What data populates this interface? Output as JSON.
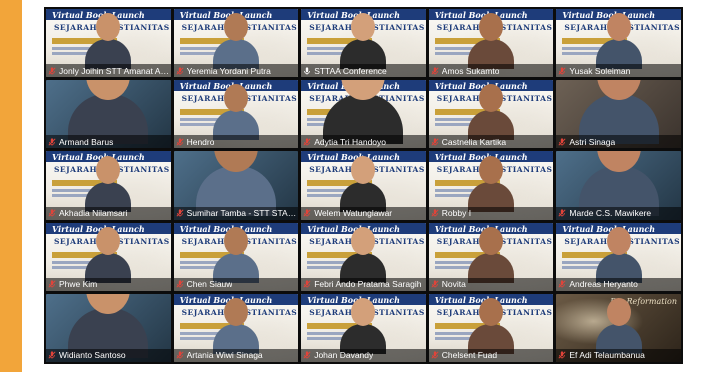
{
  "banner": {
    "script_title": "Virtual Book Launch",
    "main_title": "SEJARAH KRISTIANITAS"
  },
  "painting_caption": "Die Reformation",
  "colors": {
    "accent": "#f2a53a",
    "banner_blue": "#1e3c7a",
    "speaking_border": "#9ad94a",
    "muted_mic": "#e0443a"
  },
  "participants": [
    {
      "name": "Jonly Joihin STT Amanat Ag...",
      "mic": "muted",
      "video": "banner"
    },
    {
      "name": "Yeremia Yordani Putra",
      "mic": "muted",
      "video": "banner",
      "speaking": true
    },
    {
      "name": "STTAA Conference",
      "mic": "unmuted",
      "video": "banner"
    },
    {
      "name": "Amos Sukamto",
      "mic": "muted",
      "video": "banner"
    },
    {
      "name": "Yusak Soleiman",
      "mic": "muted",
      "video": "banner"
    },
    {
      "name": "Armand Barus",
      "mic": "muted",
      "video": "camera"
    },
    {
      "name": "Hendro",
      "mic": "muted",
      "video": "banner"
    },
    {
      "name": "Adytia Tri Handoyo",
      "mic": "muted",
      "video": "banner"
    },
    {
      "name": "Castnelia Kartika",
      "mic": "muted",
      "video": "banner"
    },
    {
      "name": "Astri Sinaga",
      "mic": "muted",
      "video": "camera"
    },
    {
      "name": "Akhadia Nilamsari",
      "mic": "muted",
      "video": "banner"
    },
    {
      "name": "Sumihar Tamba - STT STAR ...",
      "mic": "muted",
      "video": "camera"
    },
    {
      "name": "Welem Watunglawar",
      "mic": "muted",
      "video": "banner"
    },
    {
      "name": "Robby I",
      "mic": "muted",
      "video": "banner"
    },
    {
      "name": "Marde C.S. Mawikere",
      "mic": "muted",
      "video": "camera"
    },
    {
      "name": "Phwe Kim",
      "mic": "muted",
      "video": "banner"
    },
    {
      "name": "Chen Siauw",
      "mic": "muted",
      "video": "banner"
    },
    {
      "name": "Febri Ando Pratama Saragih",
      "mic": "muted",
      "video": "banner"
    },
    {
      "name": "Novita",
      "mic": "muted",
      "video": "banner"
    },
    {
      "name": "Andreas Heryanto",
      "mic": "muted",
      "video": "banner"
    },
    {
      "name": "Widianto Santoso",
      "mic": "muted",
      "video": "camera"
    },
    {
      "name": "Artania Wiwi Sinaga",
      "mic": "muted",
      "video": "banner"
    },
    {
      "name": "Johan Davandy",
      "mic": "muted",
      "video": "banner"
    },
    {
      "name": "Chelsent Fuad",
      "mic": "muted",
      "video": "banner"
    },
    {
      "name": "Ef Adi Telaumbanua",
      "mic": "muted",
      "video": "painting"
    }
  ]
}
